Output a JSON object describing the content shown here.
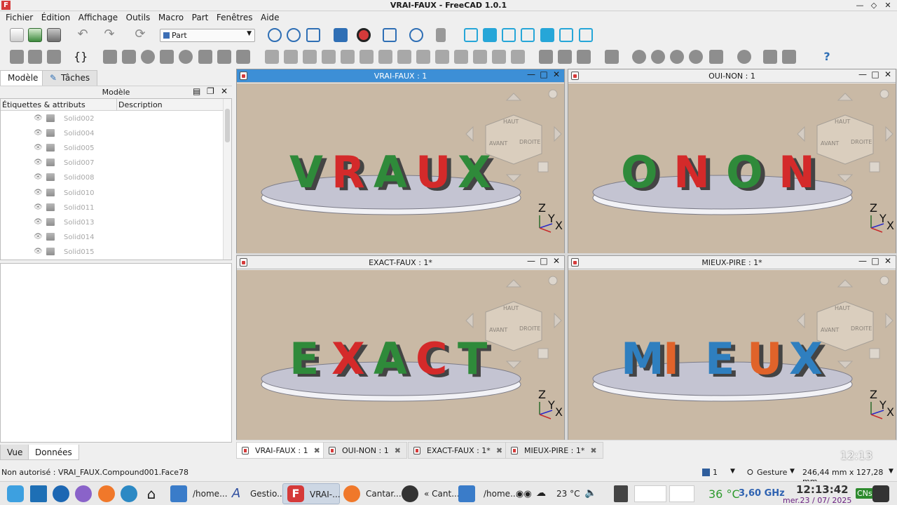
{
  "window": {
    "title": "VRAI-FAUX - FreeCAD 1.0.1",
    "app_icon": "F"
  },
  "menu": [
    "Fichier",
    "Édition",
    "Affichage",
    "Outils",
    "Macro",
    "Part",
    "Fenêtres",
    "Aide"
  ],
  "workbench": {
    "selected": "Part"
  },
  "left_panel": {
    "tabs": [
      "Modèle",
      "Tâches"
    ],
    "header": "Modèle",
    "columns": [
      "Étiquettes & attributs",
      "Description"
    ],
    "tree_items": [
      "Solid002",
      "Solid004",
      "Solid005",
      "Solid007",
      "Solid008",
      "Solid010",
      "Solid011",
      "Solid013",
      "Solid014",
      "Solid015"
    ],
    "bottom_tabs": [
      "Vue",
      "Données"
    ]
  },
  "views": [
    {
      "title": "VRAI-FAUX : 1",
      "word": "VRAUX",
      "colors": [
        "#2f8a3a",
        "#d42a2a"
      ]
    },
    {
      "title": "OUI-NON : 1",
      "word": "ONON",
      "colors": [
        "#2f8a3a",
        "#d42a2a"
      ]
    },
    {
      "title": "EXACT-FAUX : 1*",
      "word": "EXACT",
      "colors": [
        "#2f8a3a",
        "#d42a2a"
      ]
    },
    {
      "title": "MIEUX-PIRE : 1*",
      "word": "MIEUX",
      "colors": [
        "#2f7fbf",
        "#e0632a"
      ]
    }
  ],
  "navcube": {
    "top": "HAUT",
    "front": "AVANT",
    "right": "DROITE"
  },
  "axis_labels": {
    "z": "Z",
    "y": "Y",
    "x": "X"
  },
  "doc_tabs": [
    "VRAI-FAUX : 1",
    "OUI-NON : 1",
    "EXACT-FAUX : 1*",
    "MIEUX-PIRE : 1*"
  ],
  "overlay_clock": "12:13",
  "status": {
    "message": "Non autorisé : VRAI_FAUX.Compound001.Face78",
    "page": "1",
    "nav_style": "Gesture",
    "dimensions": "246,44 mm x 127,28 mm"
  },
  "taskbar": {
    "tasks": [
      "/home...",
      "Gestio...",
      "VRAI-...",
      "Cantar...",
      "« Cant...",
      "/home..."
    ],
    "weather": "23 °C",
    "cpu_temp": "36 °C",
    "cpu_freq": "3,60 GHz",
    "time": "12:13:42",
    "date": "mer.23 / 07/ 2025",
    "badge": "CNs"
  }
}
